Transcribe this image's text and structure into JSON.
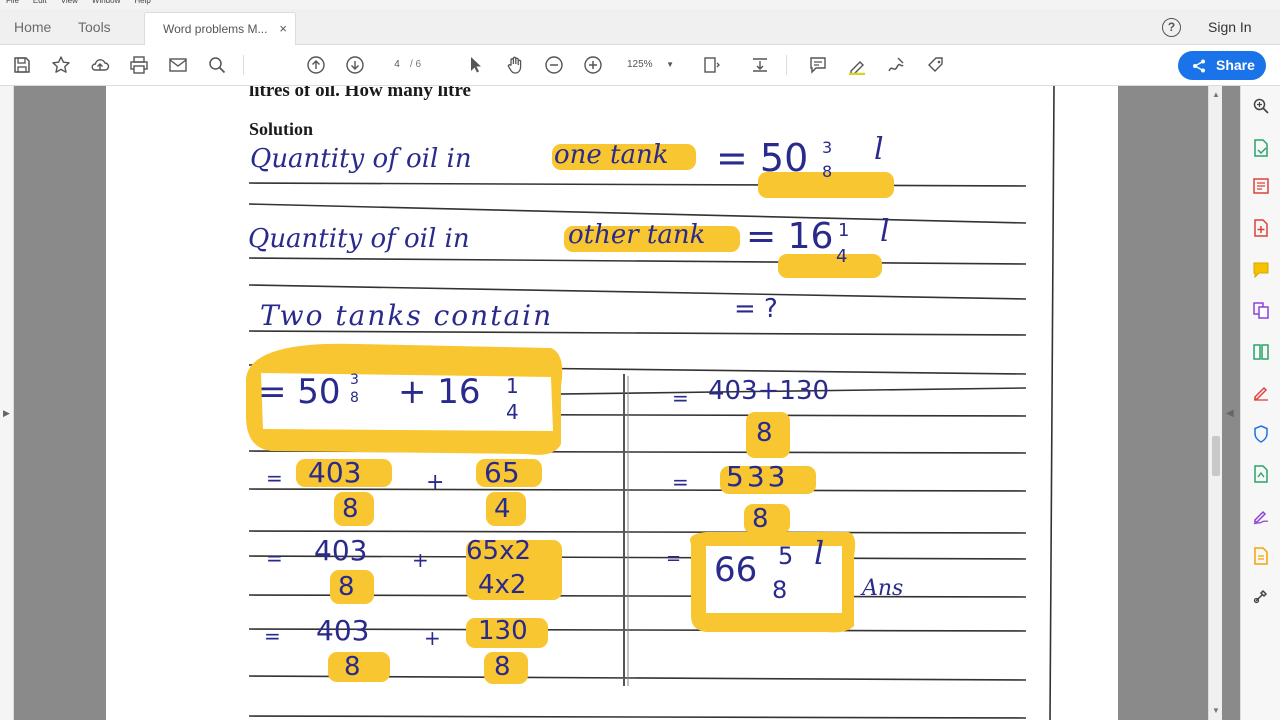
{
  "menu": [
    "File",
    "Edit",
    "View",
    "Window",
    "Help"
  ],
  "tabs": {
    "home": "Home",
    "tools": "Tools",
    "document": "Word problems M...",
    "close": "×"
  },
  "header": {
    "help": "?",
    "sign_in": "Sign In"
  },
  "toolbar": {
    "page_current": "4",
    "page_total": "/ 6",
    "zoom": "125%",
    "share": "Share"
  },
  "document": {
    "cut_line": "litres of oil. How many litre",
    "solution_heading": "Solution",
    "line1_label": "Quantity of oil in",
    "line1_hl": "one tank",
    "line1_value": "= 50",
    "line1_num": "3",
    "line1_den": "8",
    "line1_unit": "l",
    "line2_label": "Quantity of oil in",
    "line2_hl": "other tank",
    "line2_value": "= 16",
    "line2_num": "1",
    "line2_den": "4",
    "line2_unit": "l",
    "line3_label": "Two tanks contain",
    "line3_value": "= ?",
    "step1": "= 50",
    "step1_frac1_num": "3",
    "step1_frac1_den": "8",
    "step1_plus": "+ 16",
    "step1_frac2_num": "1",
    "step1_frac2_den": "4",
    "step2_eq": "=",
    "step2_a_num": "403",
    "step2_a_den": "8",
    "step2_plus": "+",
    "step2_b_num": "65",
    "step2_b_den": "4",
    "step3_eq": "=",
    "step3_a_num": "403",
    "step3_a_den": "8",
    "step3_plus": "+",
    "step3_b_num": "65x2",
    "step3_b_den": "4x2",
    "step4_eq": "=",
    "step4_a_num": "403",
    "step4_a_den": "8",
    "step4_plus": "+",
    "step4_b_num": "130",
    "step4_b_den": "8",
    "r1_eq": "=",
    "r1_num": "403+130",
    "r1_den": "8",
    "r2_eq": "=",
    "r2_num": "533",
    "r2_den": "8",
    "r3_eq": "=",
    "r3_whole": "66",
    "r3_num": "5",
    "r3_den": "8",
    "r3_unit": "l",
    "answer_mark": "Ans"
  },
  "colors": {
    "highlight": "#f8c630",
    "ink": "#2a2a8c",
    "accent": "#1a73e8"
  }
}
